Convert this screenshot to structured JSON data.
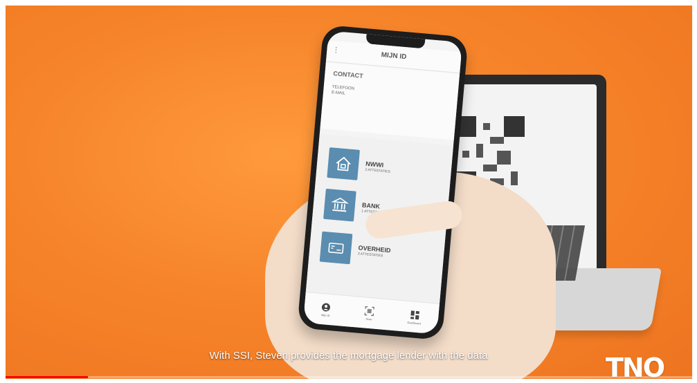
{
  "phone": {
    "title": "MIJN ID",
    "menu_glyph": "⋮",
    "contact": {
      "heading": "CONTACT",
      "lines": [
        "TELEFOON",
        "E-MAIL"
      ]
    },
    "cards": [
      {
        "title": "NWWI",
        "subtitle": "2 ATTESTATIES",
        "icon": "house-icon"
      },
      {
        "title": "BANK",
        "subtitle": "1 ATTESTATIE",
        "icon": "bank-icon"
      },
      {
        "title": "OVERHEID",
        "subtitle": "3 ATTESTATIES",
        "icon": "id-card-icon"
      }
    ],
    "nav": [
      {
        "label": "Mijn ID",
        "icon": "user-icon"
      },
      {
        "label": "Scan",
        "icon": "qr-scan-icon"
      },
      {
        "label": "Dashboard",
        "icon": "dashboard-icon"
      }
    ],
    "card_icon_color": "#5a8db0"
  },
  "video": {
    "subtitle": "With SSI, Steven provides the mortgage lender with the data",
    "logo": "TNO",
    "progress": 0.12,
    "progress_color": "#ff0000",
    "background_color": "#f6842a"
  }
}
